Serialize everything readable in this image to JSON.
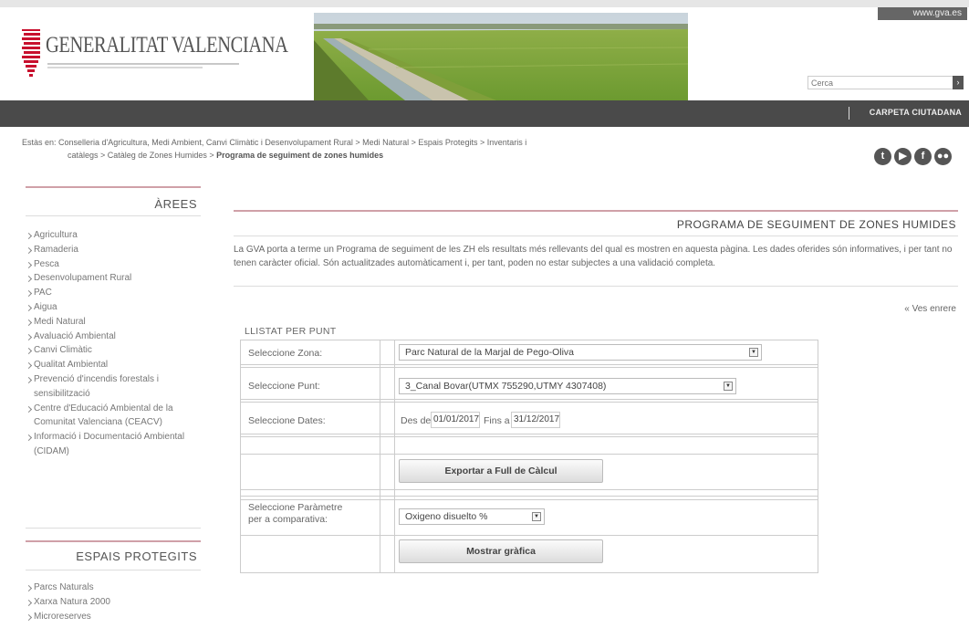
{
  "header": {
    "site_link": "www.gva.es",
    "logo_text": "GENERALITAT VALENCIANA",
    "search_placeholder": "Cerca",
    "carpeta_label": "CARPETA CIUTADANA"
  },
  "breadcrumb": {
    "line1": "Estàs en:  Conselleria d'Agricultura, Medi Ambient, Canvi Climàtic i Desenvolupament Rural  >  Medi Natural  >  Espais Protegits  >  Inventaris i",
    "line2_prefix": "catàlegs  >  Catàleg de Zones Humides  >  ",
    "current": "Programa de seguiment de zones humides"
  },
  "social_icons": [
    "twitter-icon",
    "youtube-icon",
    "facebook-icon",
    "flickr-icon"
  ],
  "sidebar": {
    "arees_title": "ÀREES",
    "arees_items": [
      "Agricultura",
      "Ramaderia",
      "Pesca",
      "Desenvolupament Rural",
      "PAC",
      "Aigua",
      "Medi Natural",
      "Avaluació Ambiental",
      "Canvi Climàtic",
      "Qualitat Ambiental",
      "Prevenció d'incendis forestals i sensibilització",
      "Centre d'Educació Ambiental de la Comunitat Valenciana (CEACV)",
      "Informació i Documentació Ambiental (CIDAM)"
    ],
    "espais_title": "ESPAIS PROTEGITS",
    "espais_items": [
      "Parcs Naturals",
      "Xarxa Natura 2000",
      "Microreserves"
    ]
  },
  "main": {
    "title": "PROGRAMA DE SEGUIMENT DE ZONES HUMIDES",
    "intro": "La GVA porta a terme un Programa de seguiment de les ZH els resultats més rellevants del qual es mostren en aquesta pàgina. Les dades oferides són informatives, i per tant no tenen caràcter oficial. Són actualitzades automàticament i, per tant, poden no estar subjectes a una validació completa.",
    "ves_enrere": "« Ves enrere",
    "llistat_label": "LLISTAT PER PUNT",
    "form": {
      "zona_label": "Seleccione Zona:",
      "zona_value": "Parc Natural de la Marjal de Pego-Oliva",
      "punt_label": "Seleccione Punt:",
      "punt_value": "3_Canal Bovar(UTMX 755290,UTMY 4307408)",
      "dates_label": "Seleccione Dates:",
      "des_de": "Des de",
      "date_from": "01/01/2017",
      "fins_a": "Fins a",
      "date_to": "31/12/2017",
      "export_button": "Exportar a Full de Càlcul",
      "param_label_1": "Seleccione Paràmetre",
      "param_label_2": "per a comparativa:",
      "param_value": "Oxigeno disuelto %",
      "show_button": "Mostrar gràfica"
    }
  }
}
